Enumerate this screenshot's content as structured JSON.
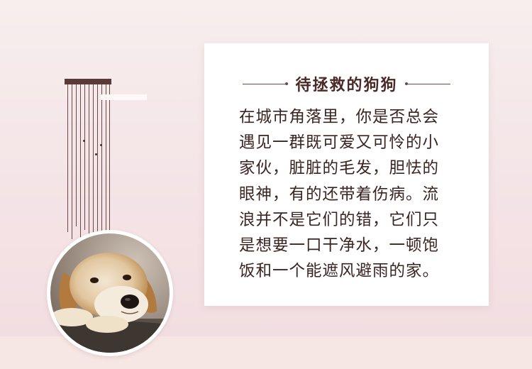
{
  "card": {
    "title": "待拯救的狗狗",
    "lines": [
      "在城市角落里，你是否总会",
      "遇见一群既可爱又可怜的小",
      "家伙，脏脏的毛发，胆怯的",
      "眼神，有的还带着伤病。流",
      "浪并不是它们的错，它们只",
      "是想要一口干净水，一顿饱",
      "饭和一个能遮风避雨的家。"
    ]
  },
  "photo": {
    "subject": "golden-retriever-dog"
  },
  "colors": {
    "background": "#f4e3e6",
    "text": "#3b2420",
    "accent": "#5a3a36"
  }
}
